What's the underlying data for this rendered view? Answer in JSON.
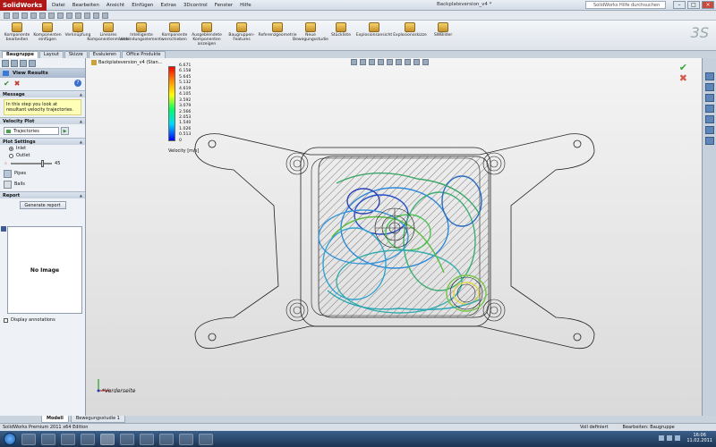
{
  "app": {
    "logo_text": "SolidWorks",
    "document_title": "Backplateversion_v4 *",
    "help_search_placeholder": "SolidWorks Hilfe durchsuchen",
    "menus": [
      "Datei",
      "Bearbeiten",
      "Ansicht",
      "Einfügen",
      "Extras",
      "3Dcontrol",
      "Fenster",
      "Hilfe"
    ]
  },
  "ribbon": {
    "buttons": [
      "Komponente bearbeiten",
      "Komponenten einfügen",
      "Verknüpfung",
      "Lineares Komponentenmuster",
      "Intelligente Verbindungselemente",
      "Komponente verschieben",
      "Ausgeblendete Komponenten anzeigen",
      "Baugruppen-Features",
      "Referenzgeometrie",
      "Neue Bewegungsstudie",
      "Stückliste",
      "Explosionsansicht",
      "Explosionsskizze",
      "SWBilder"
    ]
  },
  "tabs": [
    "Baugruppe",
    "Layout",
    "Skizze",
    "Evaluieren",
    "Office Produkte"
  ],
  "panel": {
    "title": "View Results",
    "message_header": "Message",
    "message_text": "In this step you look at resultant velocity trajectories.",
    "velocity_plot_header": "Velocity Plot",
    "velocity_plot_value": "Trajectories",
    "plot_settings_header": "Plot Settings",
    "inlet_label": "Inlet",
    "outlet_label": "Outlet",
    "slider_value": "45",
    "pipes_label": "Pipes",
    "balls_label": "Balls",
    "report_header": "Report",
    "generate_report_label": "Generate report",
    "no_image_label": "No Image",
    "display_annotations_label": "Display annotations"
  },
  "viewport": {
    "tree_node_label": "Backplateversion_v4 (Stan...",
    "view_label": "*Vorderseite",
    "legend": {
      "ticks": [
        "6.671",
        "6.158",
        "5.645",
        "5.132",
        "4.619",
        "4.105",
        "3.592",
        "3.079",
        "2.566",
        "2.053",
        "1.540",
        "1.026",
        "0.513",
        "0"
      ],
      "unit_label": "Velocity [m/s]",
      "colors": [
        "#ff0000",
        "#ff8800",
        "#ffff00",
        "#00ff66",
        "#00d8ff",
        "#0000ff"
      ]
    }
  },
  "bottom_tabs": [
    "Modell",
    "Bewegungsstudie 1"
  ],
  "status": {
    "left": "SolidWorks Premium 2011 x64 Edition",
    "state": "Voll definiert",
    "mode": "Bearbeiten: Baugruppe"
  },
  "clock": {
    "time": "16:06",
    "date": "11.02.2011"
  }
}
